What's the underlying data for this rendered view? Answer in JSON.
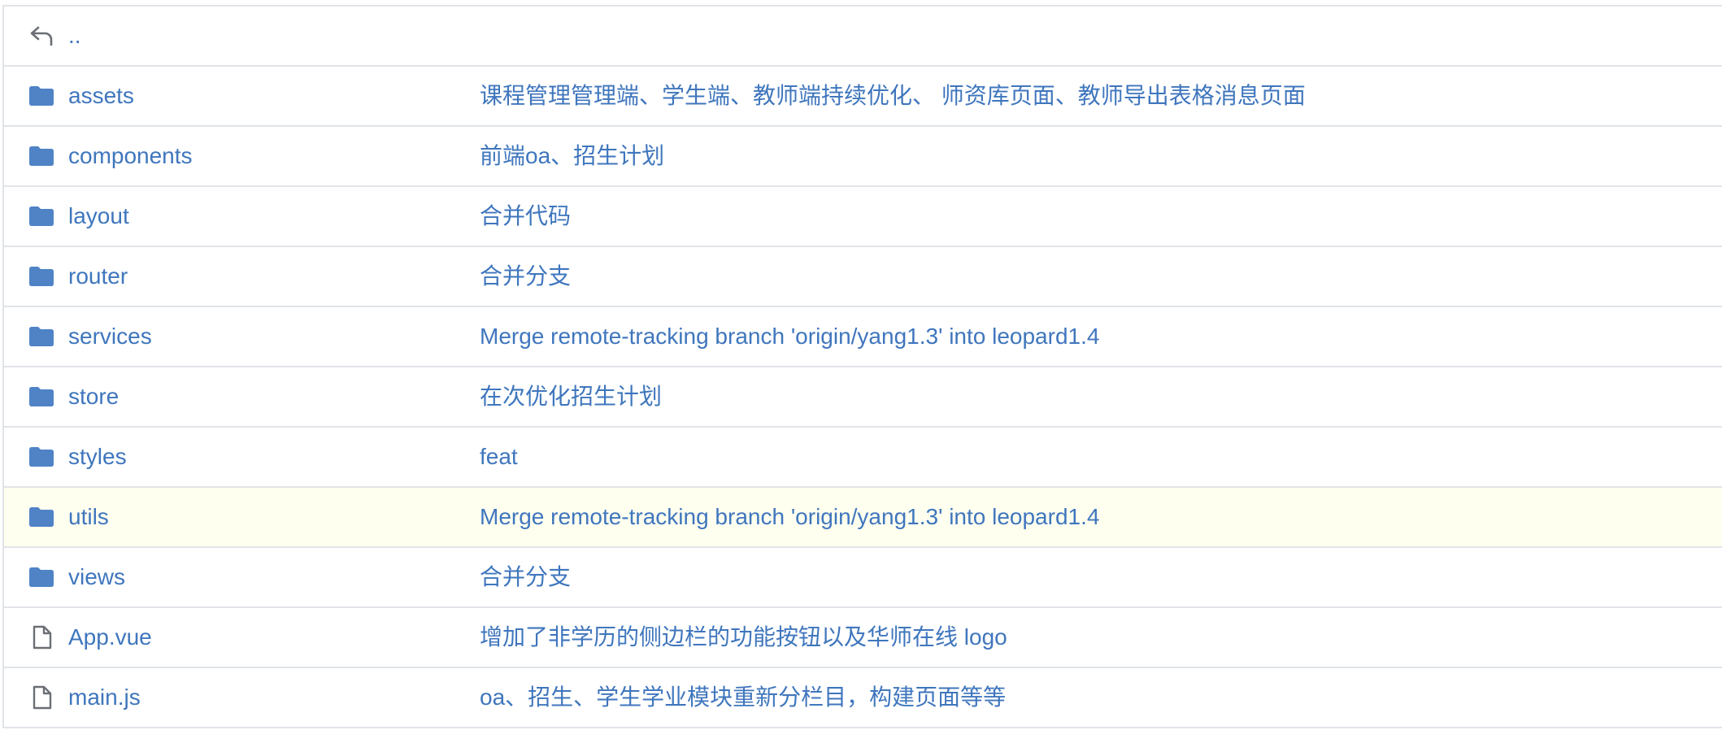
{
  "parent": {
    "label": "..",
    "icon": "return-arrow-icon"
  },
  "entries": [
    {
      "name": "assets",
      "type": "folder",
      "icon": "folder-icon",
      "message": "课程管理管理端、学生端、教师端持续优化、 师资库页面、教师导出表格消息页面"
    },
    {
      "name": "components",
      "type": "folder",
      "icon": "folder-icon",
      "message": "前端oa、招生计划"
    },
    {
      "name": "layout",
      "type": "folder",
      "icon": "folder-icon",
      "message": "合并代码"
    },
    {
      "name": "router",
      "type": "folder",
      "icon": "folder-icon",
      "message": "合并分支"
    },
    {
      "name": "services",
      "type": "folder",
      "icon": "folder-icon",
      "message": "Merge remote-tracking branch 'origin/yang1.3' into leopard1.4"
    },
    {
      "name": "store",
      "type": "folder",
      "icon": "folder-icon",
      "message": "在次优化招生计划"
    },
    {
      "name": "styles",
      "type": "folder",
      "icon": "folder-icon",
      "message": "feat"
    },
    {
      "name": "utils",
      "type": "folder",
      "icon": "folder-icon",
      "message": "Merge remote-tracking branch 'origin/yang1.3' into leopard1.4"
    },
    {
      "name": "views",
      "type": "folder",
      "icon": "folder-icon",
      "message": "合并分支"
    },
    {
      "name": "App.vue",
      "type": "file",
      "icon": "file-icon",
      "message": "增加了非学历的侧边栏的功能按钮以及华师在线 logo"
    },
    {
      "name": "main.js",
      "type": "file",
      "icon": "file-icon",
      "message": "oa、招生、学生学业模块重新分栏目，构建页面等等"
    }
  ],
  "colors": {
    "link": "#3f76bd",
    "folder": "#4f83c6",
    "file_icon": "#6b6f75",
    "row_highlight": "#fffff0",
    "border": "#e1e4e8"
  }
}
